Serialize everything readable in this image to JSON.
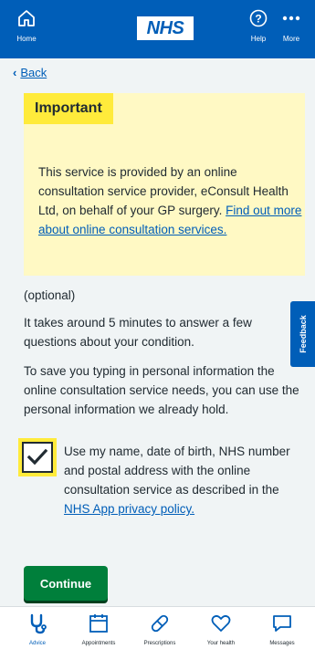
{
  "topbar": {
    "logo": "NHS",
    "home_label": "Home",
    "help_label": "Help",
    "more_label": "More"
  },
  "back_label": "Back",
  "important": {
    "heading": "Important",
    "text": "This service is provided by an online consultation service provider, eConsult Health Ltd, on behalf of your GP surgery. ",
    "link": "Find out more about online consultation services."
  },
  "content": {
    "optional": "(optional)",
    "p1": "It takes around 5 minutes to answer a few questions about your condition.",
    "p2": "To save you typing in personal information the online consultation service needs, you can use the personal information we already hold."
  },
  "checkbox": {
    "checked": true,
    "text": "Use my name, date of birth, NHS number and postal address with the online consultation service as described in the ",
    "link": "NHS App privacy policy."
  },
  "continue_label": "Continue",
  "feedback_label": "Feedback",
  "bottom_nav": [
    {
      "label": "Advice",
      "icon": "stethoscope-icon",
      "active": true
    },
    {
      "label": "Appointments",
      "icon": "calendar-icon",
      "active": false
    },
    {
      "label": "Prescriptions",
      "icon": "pill-icon",
      "active": false
    },
    {
      "label": "Your health",
      "icon": "heart-icon",
      "active": false
    },
    {
      "label": "Messages",
      "icon": "message-icon",
      "active": false
    }
  ],
  "colors": {
    "nhs_blue": "#005eb8",
    "warning_yellow": "#ffeb3b",
    "callout_bg": "#fff9c4",
    "continue_green": "#007f3b",
    "page_bg": "#f0f4f5"
  }
}
